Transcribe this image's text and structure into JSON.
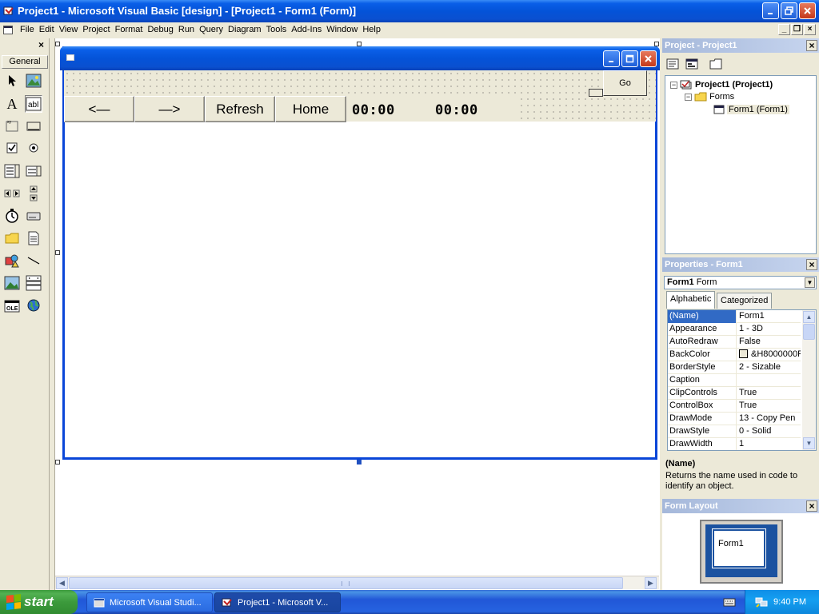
{
  "window": {
    "title": "Project1 - Microsoft Visual Basic [design] - [Project1 - Form1 (Form)]"
  },
  "menu": {
    "items": [
      {
        "accel": "F",
        "rest": "ile"
      },
      {
        "accel": "E",
        "rest": "dit"
      },
      {
        "accel": "V",
        "rest": "iew"
      },
      {
        "accel": "P",
        "rest": "roject"
      },
      {
        "accel": "",
        "pre": "F",
        "accel2": "o",
        "rest": "rmat"
      },
      {
        "accel": "D",
        "rest": "ebug"
      },
      {
        "accel": "R",
        "rest": "un"
      },
      {
        "accel": "Q",
        "rest": "uery"
      },
      {
        "pre": "D",
        "accel": "i",
        "rest": "agram"
      },
      {
        "accel": "T",
        "rest": "ools"
      },
      {
        "accel": "A",
        "rest": "dd-Ins"
      },
      {
        "accel": "W",
        "rest": "indow"
      },
      {
        "accel": "H",
        "rest": "elp"
      }
    ],
    "labels": [
      "File",
      "Edit",
      "View",
      "Project",
      "Format",
      "Debug",
      "Run",
      "Query",
      "Diagram",
      "Tools",
      "Add-Ins",
      "Window",
      "Help"
    ]
  },
  "toolbox": {
    "tab_label": "General",
    "tools": [
      "pointer-icon",
      "picturebox-icon",
      "label-icon",
      "textbox-icon",
      "frame-icon",
      "commandbutton-icon",
      "checkbox-icon",
      "optionbutton-icon",
      "combobox-icon",
      "listbox-icon",
      "hscrollbar-icon",
      "vscrollbar-icon",
      "timer-icon",
      "drivelistbox-icon",
      "dirlistbox-icon",
      "filelistbox-icon",
      "shape-icon",
      "line-icon",
      "image-icon",
      "data-icon",
      "ole-icon",
      "webbrowser-icon"
    ]
  },
  "form": {
    "buttons": {
      "back": "<—",
      "forward": "—>",
      "refresh": "Refresh",
      "home": "Home",
      "go": "Go"
    },
    "time1": "00:00",
    "time2": "00:00"
  },
  "project_panel": {
    "title": "Project - Project1",
    "tree": {
      "project": "Project1 (Project1)",
      "folder": "Forms",
      "form": "Form1 (Form1)"
    }
  },
  "properties_panel": {
    "title": "Properties - Form1",
    "object_name": "Form1",
    "object_type": "Form",
    "tabs": [
      "Alphabetic",
      "Categorized"
    ],
    "rows": [
      {
        "name": "(Name)",
        "value": "Form1"
      },
      {
        "name": "Appearance",
        "value": "1 - 3D"
      },
      {
        "name": "AutoRedraw",
        "value": "False"
      },
      {
        "name": "BackColor",
        "value": "&H8000000F"
      },
      {
        "name": "BorderStyle",
        "value": "2 - Sizable"
      },
      {
        "name": "Caption",
        "value": ""
      },
      {
        "name": "ClipControls",
        "value": "True"
      },
      {
        "name": "ControlBox",
        "value": "True"
      },
      {
        "name": "DrawMode",
        "value": "13 - Copy Pen"
      },
      {
        "name": "DrawStyle",
        "value": "0 - Solid"
      },
      {
        "name": "DrawWidth",
        "value": "1"
      }
    ],
    "desc_title": "(Name)",
    "desc_text": "Returns the name used in code to identify an object."
  },
  "form_layout_panel": {
    "title": "Form Layout",
    "form_label": "Form1"
  },
  "taskbar": {
    "start": "start",
    "tasks": [
      "Microsoft Visual Studi...",
      "Project1 - Microsoft V..."
    ],
    "clock": "9:40 PM"
  },
  "colors": {
    "xp_blue": "#0453d8",
    "face": "#ece9d8",
    "selection": "#316ac5",
    "start_green": "#3c9a3c"
  }
}
